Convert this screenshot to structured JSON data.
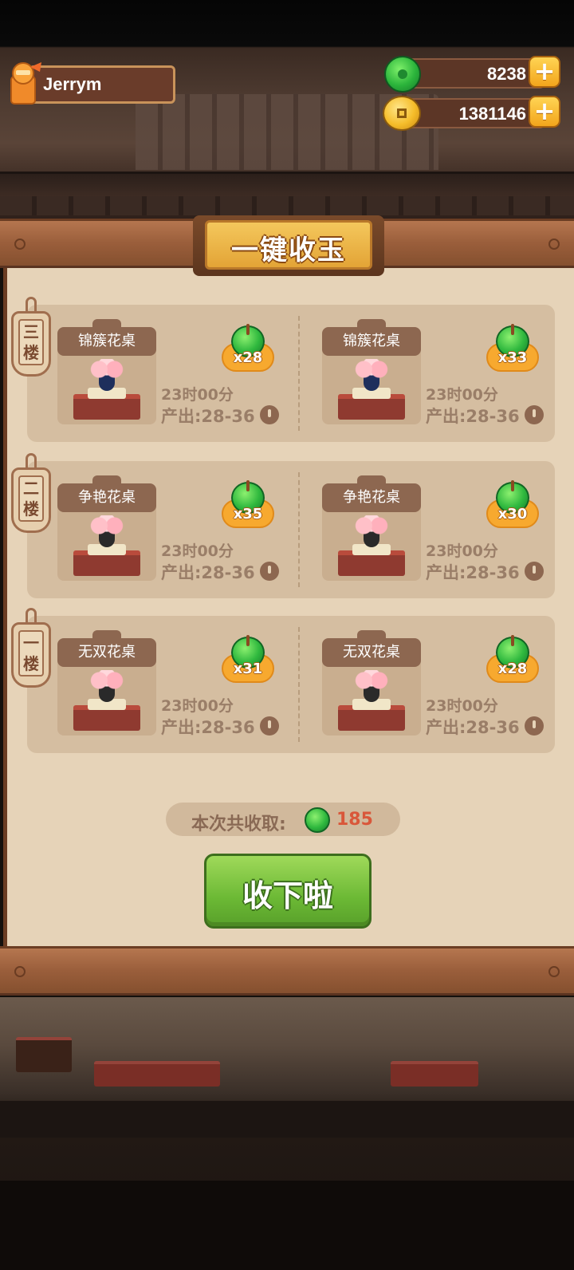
{
  "header": {
    "username": "Jerrym",
    "currencies": [
      {
        "name": "jade",
        "value": "8238",
        "icon": "jade-icon"
      },
      {
        "name": "coin",
        "value": "1381146",
        "icon": "coin-icon"
      }
    ],
    "add_button_symbol": "+"
  },
  "panel": {
    "title": "一键收玉",
    "floors": [
      {
        "tag": "三楼",
        "items": [
          {
            "name": "锦簇花桌",
            "count": "x28",
            "time": "23时00分",
            "output": "产出:28-36"
          },
          {
            "name": "锦簇花桌",
            "count": "x33",
            "time": "23时00分",
            "output": "产出:28-36"
          }
        ]
      },
      {
        "tag": "二楼",
        "items": [
          {
            "name": "争艳花桌",
            "count": "x35",
            "time": "23时00分",
            "output": "产出:28-36"
          },
          {
            "name": "争艳花桌",
            "count": "x30",
            "time": "23时00分",
            "output": "产出:28-36"
          }
        ]
      },
      {
        "tag": "一楼",
        "items": [
          {
            "name": "无双花桌",
            "count": "x31",
            "time": "23时00分",
            "output": "产出:28-36"
          },
          {
            "name": "无双花桌",
            "count": "x28",
            "time": "23时00分",
            "output": "产出:28-36"
          }
        ]
      }
    ],
    "total_label": "本次共收取:",
    "total_value": "185",
    "collect_button": "收下啦"
  },
  "colors": {
    "paper": "#e6d3b8",
    "row_bg": "#d5bea1",
    "button_green": "#6cb935",
    "badge_orange": "#f7a92f",
    "total_red": "#d9573a"
  }
}
